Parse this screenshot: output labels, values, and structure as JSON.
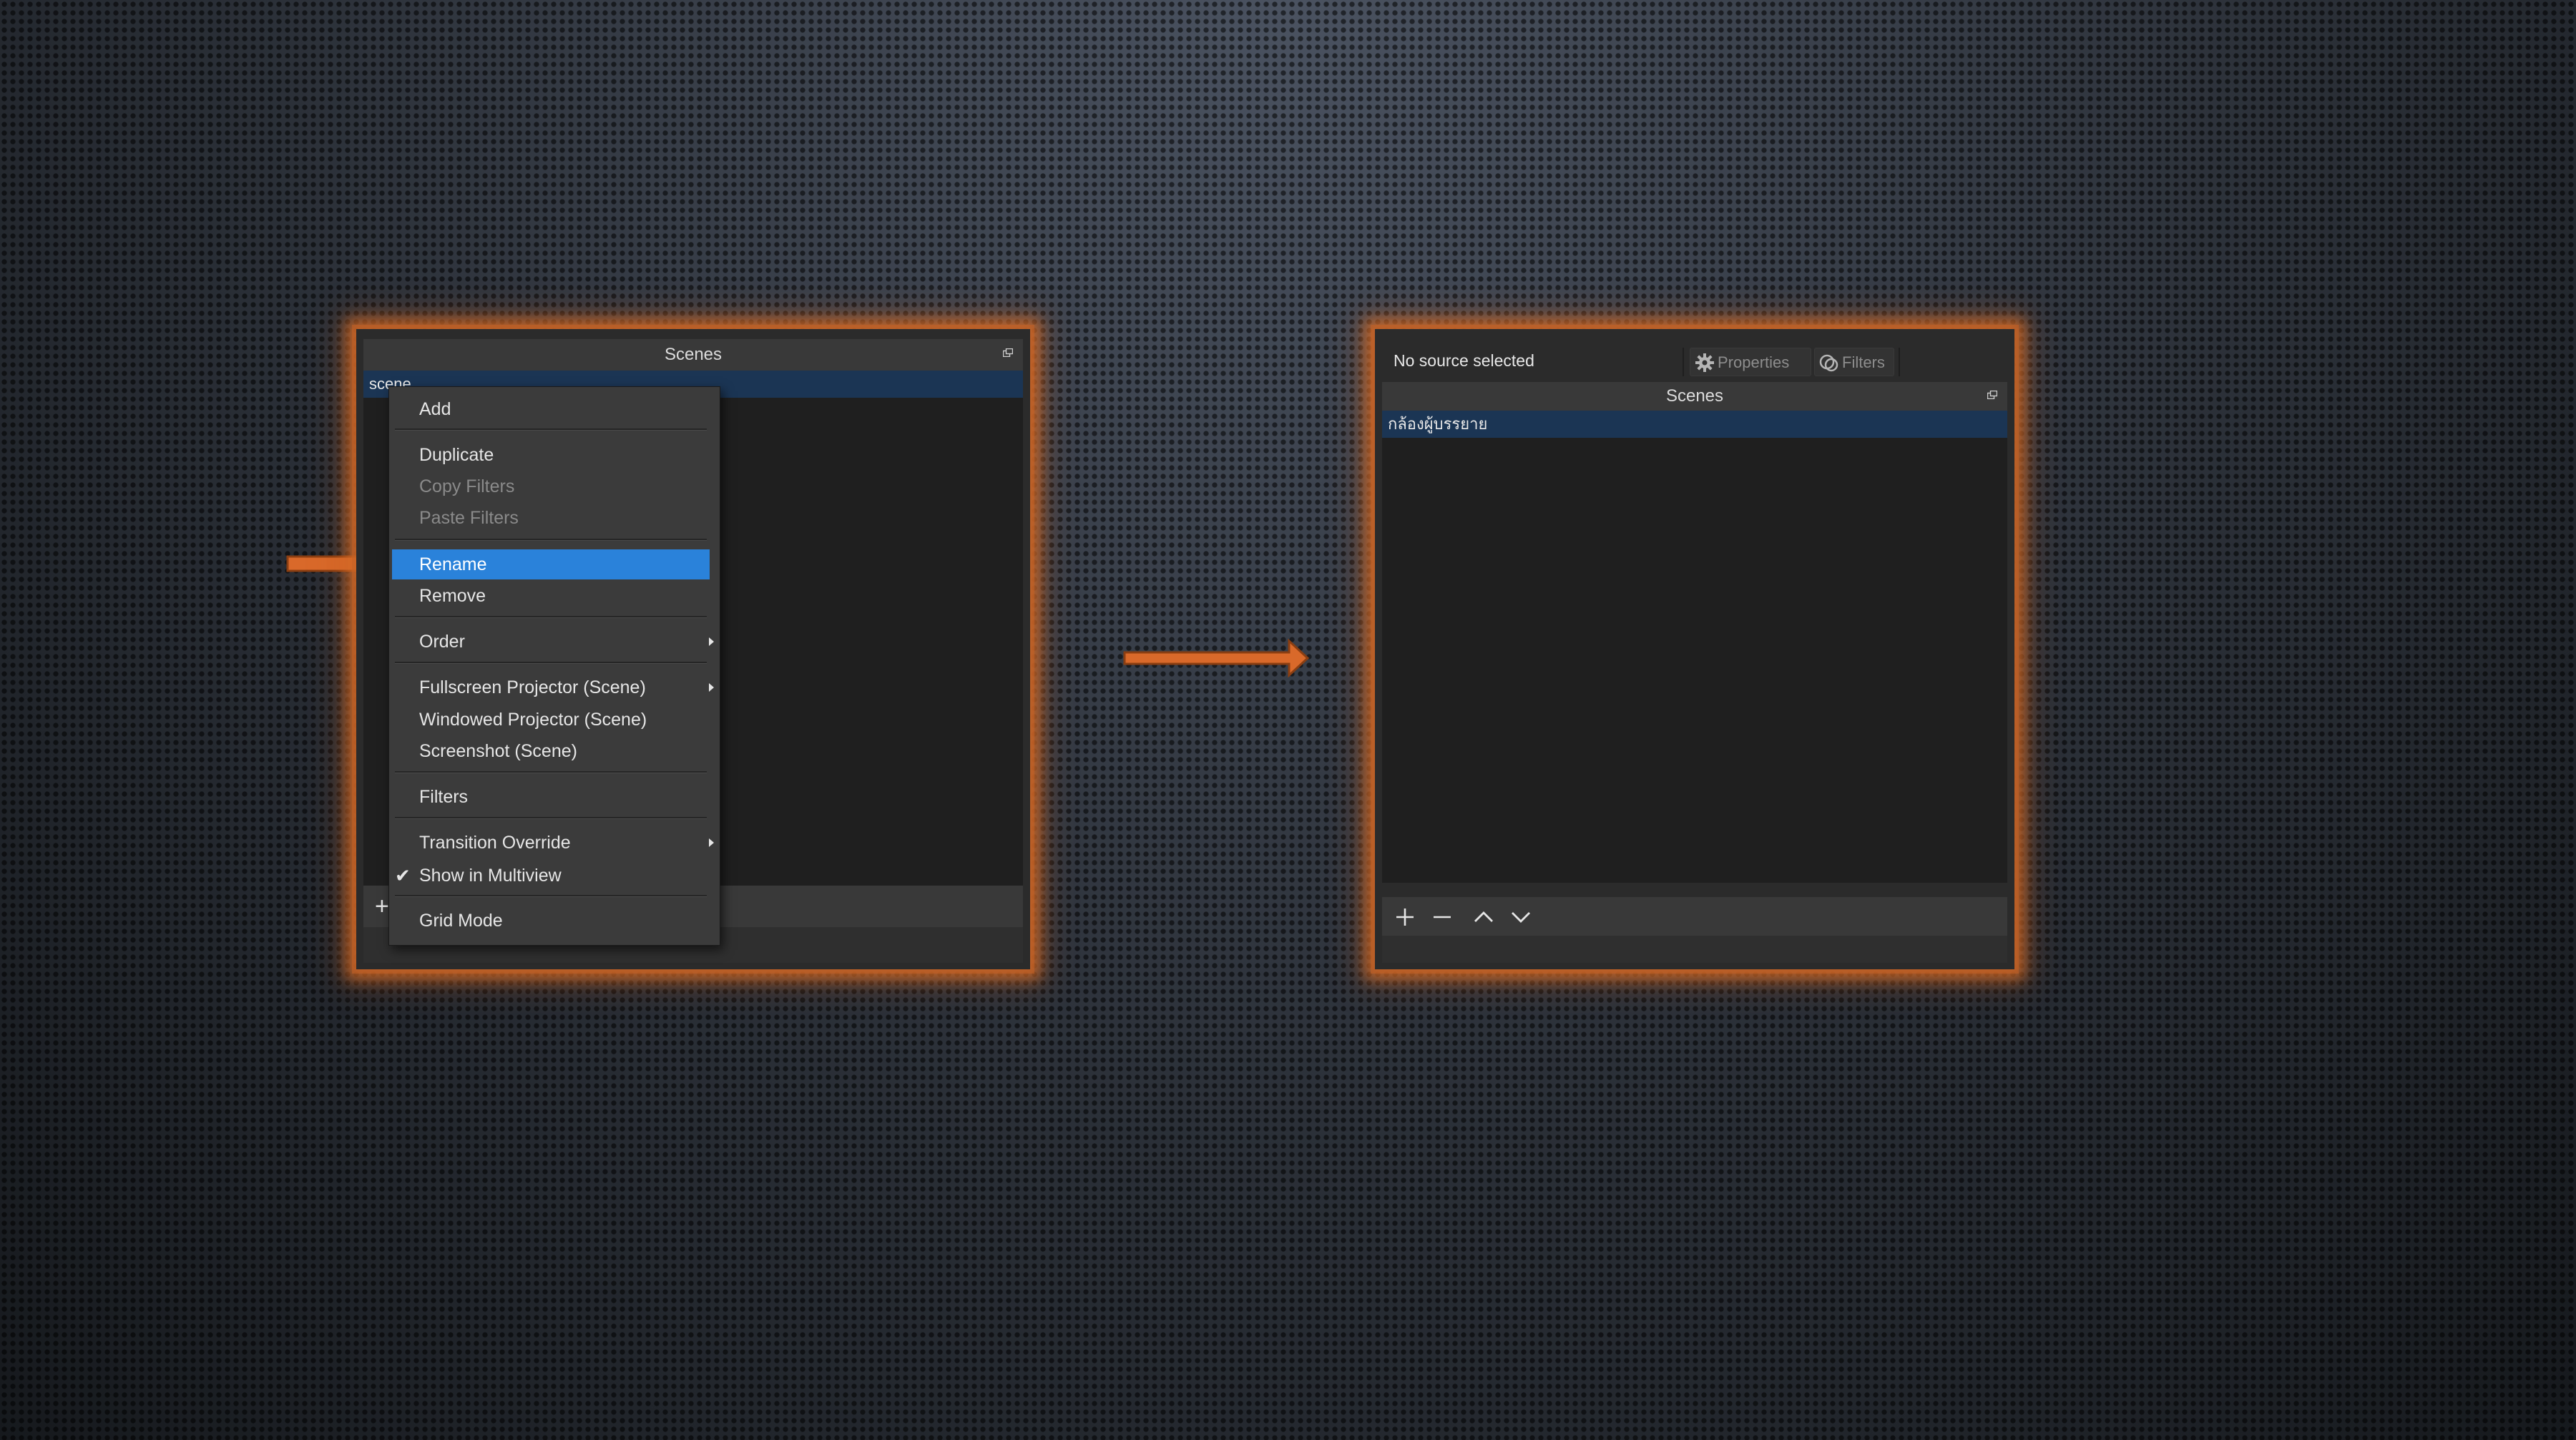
{
  "left_panel": {
    "dock_title": "Scenes",
    "scene_row_partial": "scene"
  },
  "context_menu": {
    "items": [
      {
        "label": "Add"
      },
      {
        "label": "Duplicate"
      },
      {
        "label": "Copy Filters",
        "disabled": true
      },
      {
        "label": "Paste Filters",
        "disabled": true
      },
      {
        "label": "Rename",
        "selected": true
      },
      {
        "label": "Remove"
      },
      {
        "label": "Order",
        "submenu": true
      },
      {
        "label": "Fullscreen Projector (Scene)",
        "submenu": true
      },
      {
        "label": "Windowed Projector (Scene)"
      },
      {
        "label": "Screenshot (Scene)"
      },
      {
        "label": "Filters"
      },
      {
        "label": "Transition Override",
        "submenu": true
      },
      {
        "label": "Show in Multiview",
        "checked": true
      },
      {
        "label": "Grid Mode"
      }
    ]
  },
  "right_panel": {
    "source_status": "No source selected",
    "properties_label": "Properties",
    "filters_label": "Filters",
    "dock_title": "Scenes",
    "scene_row": "กล้องผู้บรรยาย",
    "toolbar_icons": [
      "plus-icon",
      "minus-icon",
      "chevron-up-icon",
      "chevron-down-icon"
    ]
  },
  "colors": {
    "highlight": "#2a82da",
    "selected_row": "#1b3554",
    "glow": "#d46c28",
    "arrow": "#d9692a"
  }
}
